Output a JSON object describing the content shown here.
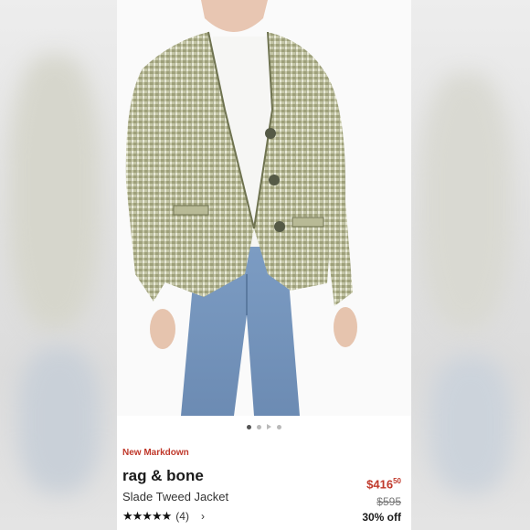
{
  "product": {
    "badge": "New Markdown",
    "brand": "rag & bone",
    "name": "Slade Tweed Jacket",
    "rating": {
      "stars_text": "★★★★★",
      "value": 5,
      "count_text": "(4)"
    },
    "price": {
      "dollars": "$416",
      "cents": "50",
      "original": "$595",
      "discount": "30% off"
    }
  },
  "carousel": {
    "count": 4,
    "active_index": 0
  },
  "icons": {
    "chevron": "chevron-right-icon",
    "play": "play-icon"
  },
  "colors": {
    "accent": "#c0392b",
    "text": "#1a1a1a"
  }
}
